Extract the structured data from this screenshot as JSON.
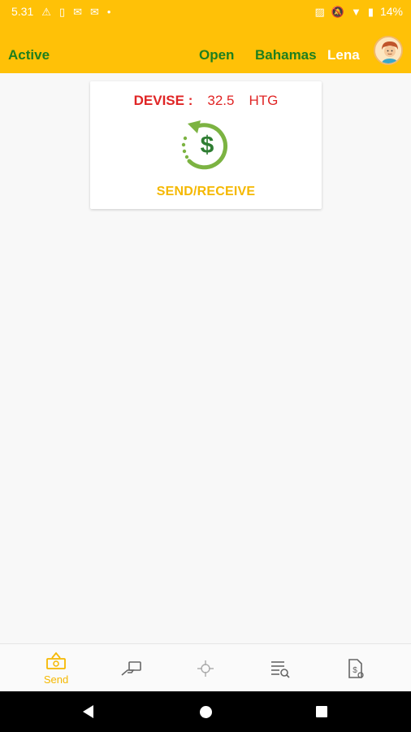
{
  "status_bar": {
    "time": "5.31",
    "battery": "14%",
    "left_icons": [
      "alert-icon",
      "sim-icon",
      "mail-icon",
      "mail-icon",
      "dot-icon"
    ],
    "right_icons": [
      "vibrate-off-icon",
      "notifications-off-icon",
      "wifi-icon",
      "battery-icon"
    ]
  },
  "header": {
    "status": "Active",
    "state": "Open",
    "country": "Bahamas",
    "user": "Lena"
  },
  "card": {
    "devise_label": "DEVISE :",
    "devise_value": "32.5",
    "currency": "HTG",
    "action_label": "SEND/RECEIVE"
  },
  "bottom_nav": {
    "items": [
      {
        "label": "Send",
        "icon": "send-money-icon",
        "active": true
      },
      {
        "label": "",
        "icon": "hand-card-icon",
        "active": false
      },
      {
        "label": "",
        "icon": "crosshair-icon",
        "active": false
      },
      {
        "label": "",
        "icon": "list-search-icon",
        "active": false
      },
      {
        "label": "",
        "icon": "document-money-icon",
        "active": false
      }
    ]
  },
  "colors": {
    "header_bg": "#ffc107",
    "header_text_green": "#1e7f1e",
    "devise_red": "#e02525",
    "accent_yellow": "#f5b800",
    "icon_green": "#7cb342"
  }
}
